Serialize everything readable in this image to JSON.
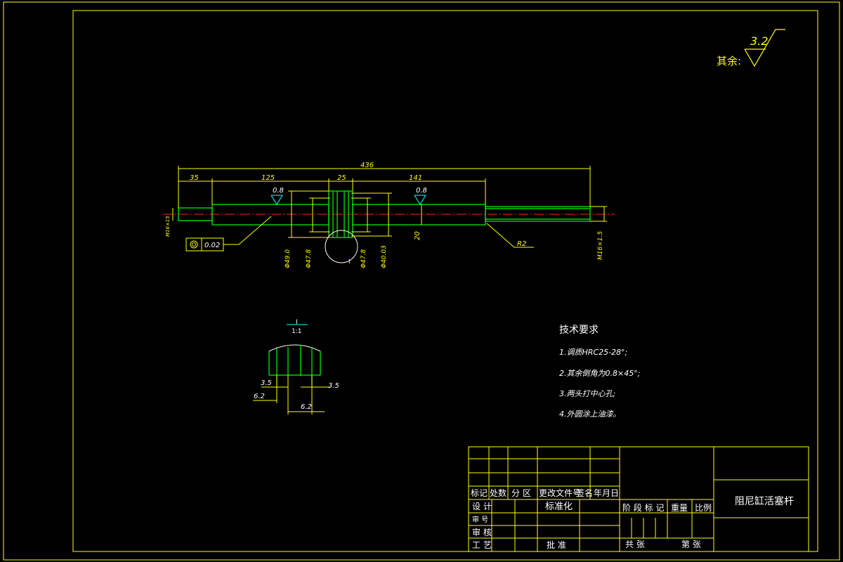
{
  "roughness": {
    "label": "其余:",
    "value": "3.2"
  },
  "dims": {
    "overall": "436",
    "d35": "35",
    "d125": "125",
    "d25": "25",
    "d141": "141",
    "dia_left": "Φ49.0",
    "dia_left2": "Φ47.8",
    "dia_right": "Φ47.8",
    "dia_right2": "Φ40.03",
    "h20": "20",
    "r2": "R2",
    "thread": "M16×1.5",
    "small_left": "M16×15",
    "rough_a": "0.8",
    "rough_b": "0.8",
    "tolerance": "0.02",
    "section_mark": "I"
  },
  "detail": {
    "label_top": "I",
    "label_bottom": "1:1",
    "dim_a": "3.5",
    "dim_b": "3.5",
    "dim_c": "6.2",
    "dim_d": "6.2"
  },
  "tech": {
    "title": "技术要求",
    "items": [
      "1.调质HRC25-28°;",
      "2.其余倒角为0.8×45°;",
      "3.两头打中心孔;",
      "4.外圆涂上油漆。"
    ]
  },
  "title_block": {
    "part_name": "阻尼缸活塞杆",
    "hdr_mark": "标记",
    "hdr_count": "处数",
    "hdr_zone": "分 区",
    "hdr_doc": "更改文件号",
    "hdr_sign": "签名",
    "hdr_date": "年月日",
    "design": "设 计",
    "standard": "标准化",
    "check": "审 核",
    "craft": "工 艺",
    "approve": "批 准",
    "review": "审 号",
    "stage": "阶 段 标 记",
    "weight": "重量",
    "scale": "比例",
    "total": "共    张",
    "sheet": "第    张"
  }
}
